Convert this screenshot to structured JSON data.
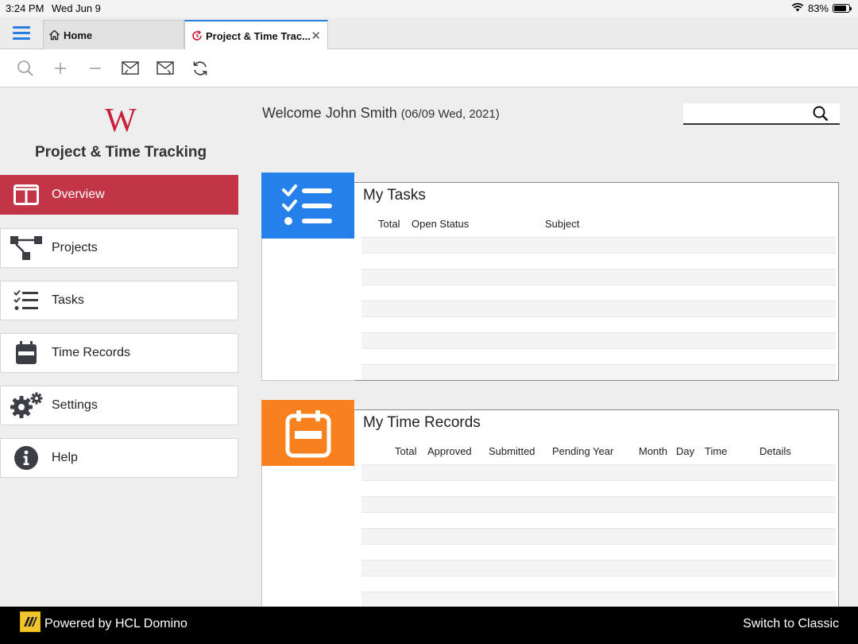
{
  "status_bar": {
    "time": "3:24 PM",
    "date": "Wed Jun 9",
    "battery": "83%",
    "battery_level": 0.83
  },
  "tabs": [
    {
      "label": "Home",
      "icon": "home-icon"
    },
    {
      "label": "Project & Time Trac...",
      "icon": "refresh-icon",
      "active": true
    }
  ],
  "toolbar": {
    "icons": [
      "search-icon",
      "plus-icon",
      "minus-icon",
      "mail-reply-icon",
      "mail-forward-icon",
      "refresh-icon"
    ]
  },
  "sidebar": {
    "logo_letter": "W",
    "app_title": "Project & Time Tracking",
    "items": [
      {
        "label": "Overview",
        "icon": "overview-icon",
        "active": true
      },
      {
        "label": "Projects",
        "icon": "projects-icon"
      },
      {
        "label": "Tasks",
        "icon": "tasks-icon"
      },
      {
        "label": "Time Records",
        "icon": "calendar-icon"
      },
      {
        "label": "Settings",
        "icon": "gear-icon"
      },
      {
        "label": "Help",
        "icon": "info-icon"
      }
    ]
  },
  "main": {
    "welcome_text": "Welcome John Smith",
    "welcome_date": "(06/09 Wed, 2021)",
    "search_value": "",
    "my_tasks": {
      "title": "My Tasks",
      "columns": [
        "Total",
        "Open Status",
        "Subject"
      ],
      "tile_color": "#2680eb"
    },
    "my_time_records": {
      "title": "My Time Records",
      "columns": [
        "Total",
        "Approved",
        "Submitted",
        "Pending Year",
        "Month",
        "Day",
        "Time",
        "Details"
      ],
      "tile_color": "#f7811e"
    }
  },
  "footer": {
    "powered_by": "Powered by HCL Domino",
    "switch_label": "Switch to Classic"
  },
  "colors": {
    "accent": "#2a7de1",
    "nav_active": "#c13547"
  }
}
